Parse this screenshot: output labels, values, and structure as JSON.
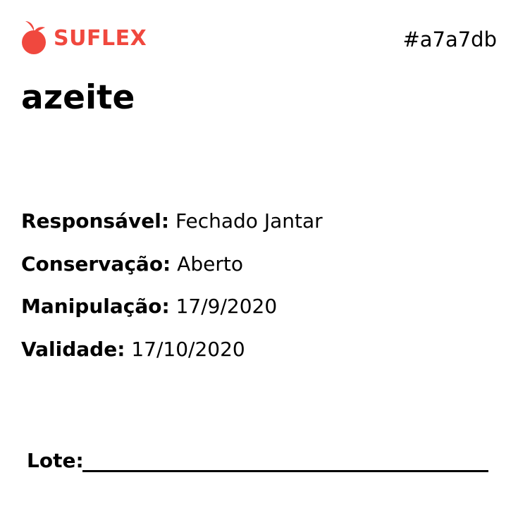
{
  "brand": {
    "name": "SUFLEX",
    "color": "#f0483e",
    "icon": "tomato-icon"
  },
  "code": "#a7a7db",
  "product": "azeite",
  "fields": [
    {
      "label": "Responsável:",
      "value": "Fechado Jantar"
    },
    {
      "label": "Conservação:",
      "value": "Aberto"
    },
    {
      "label": "Manipulação:",
      "value": "17/9/2020"
    },
    {
      "label": "Validade:",
      "value": "17/10/2020"
    }
  ],
  "lote": {
    "label": "Lote:"
  }
}
